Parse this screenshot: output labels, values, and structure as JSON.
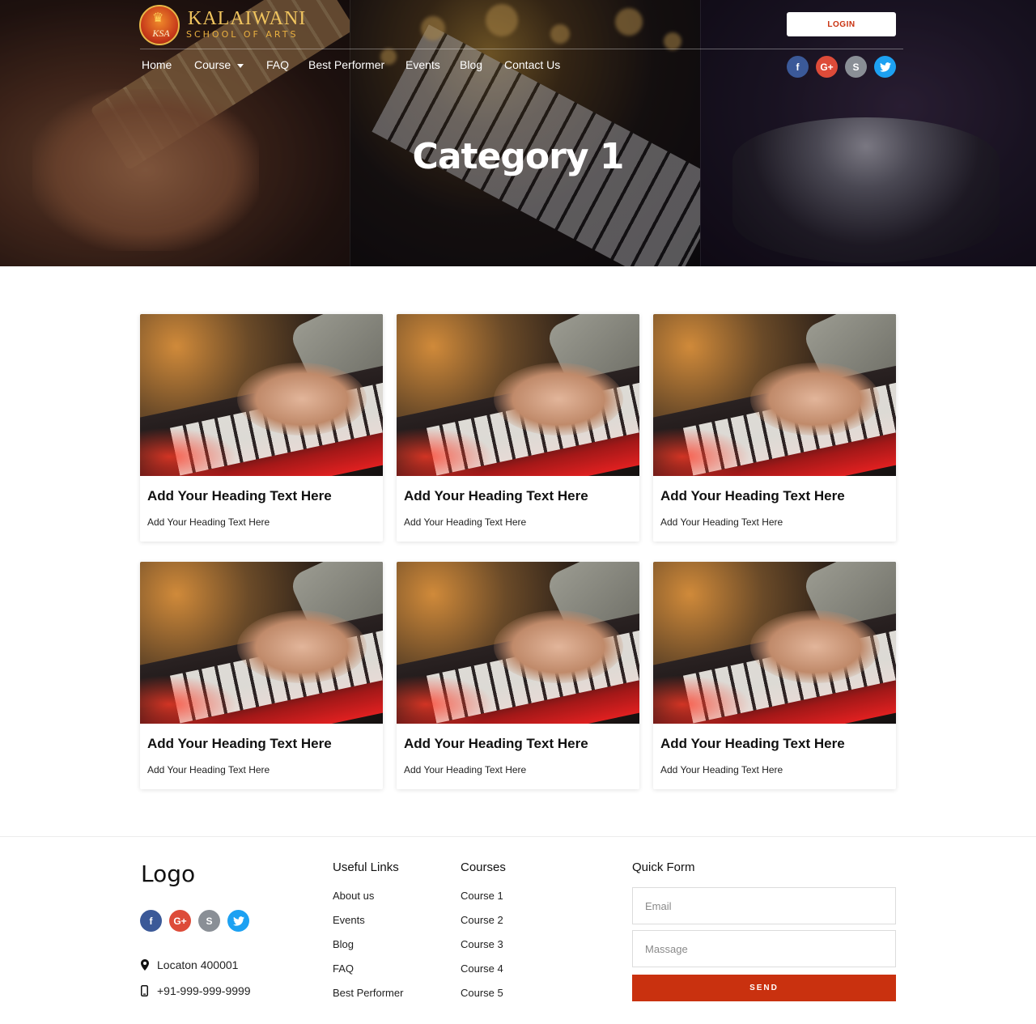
{
  "brand": {
    "name": "KALAIWANI",
    "subtitle": "SCHOOL OF ARTS",
    "crest_initials": "KSA"
  },
  "header": {
    "login_label": "LOGIN",
    "nav": [
      {
        "label": "Home"
      },
      {
        "label": "Course",
        "has_dropdown": true
      },
      {
        "label": "FAQ"
      },
      {
        "label": "Best Performer"
      },
      {
        "label": "Events"
      },
      {
        "label": "Blog"
      },
      {
        "label": "Contact Us"
      }
    ],
    "social_icons": [
      "facebook-icon",
      "google-plus-icon",
      "skype-icon",
      "twitter-icon"
    ]
  },
  "hero": {
    "title": "Category 1"
  },
  "cards": [
    {
      "title": "Add Your Heading Text Here",
      "subtitle": "Add Your Heading Text Here"
    },
    {
      "title": "Add Your Heading Text Here",
      "subtitle": "Add Your Heading Text Here"
    },
    {
      "title": "Add Your Heading Text Here",
      "subtitle": "Add Your Heading Text Here"
    },
    {
      "title": "Add Your Heading Text Here",
      "subtitle": "Add Your Heading Text Here"
    },
    {
      "title": "Add Your Heading Text Here",
      "subtitle": "Add Your Heading Text Here"
    },
    {
      "title": "Add Your Heading Text Here",
      "subtitle": "Add Your Heading Text Here"
    }
  ],
  "footer": {
    "logo": "Logo",
    "location": "Locaton 400001",
    "phone": "+91-999-999-9999",
    "useful_links": {
      "heading": "Useful Links",
      "items": [
        "About us",
        "Events",
        "Blog",
        "FAQ",
        "Best Performer"
      ]
    },
    "courses": {
      "heading": "Courses",
      "items": [
        "Course 1",
        "Course 2",
        "Course 3",
        "Course 4",
        "Course 5"
      ]
    },
    "quick_form": {
      "heading": "Quick Form",
      "email_placeholder": "Email",
      "message_placeholder": "Massage",
      "send_label": "SEND"
    }
  },
  "colors": {
    "accent": "#c9310f",
    "facebook": "#3b5998",
    "google_plus": "#dd4b39",
    "skype": "#8a8f96",
    "twitter": "#1da1f2"
  }
}
